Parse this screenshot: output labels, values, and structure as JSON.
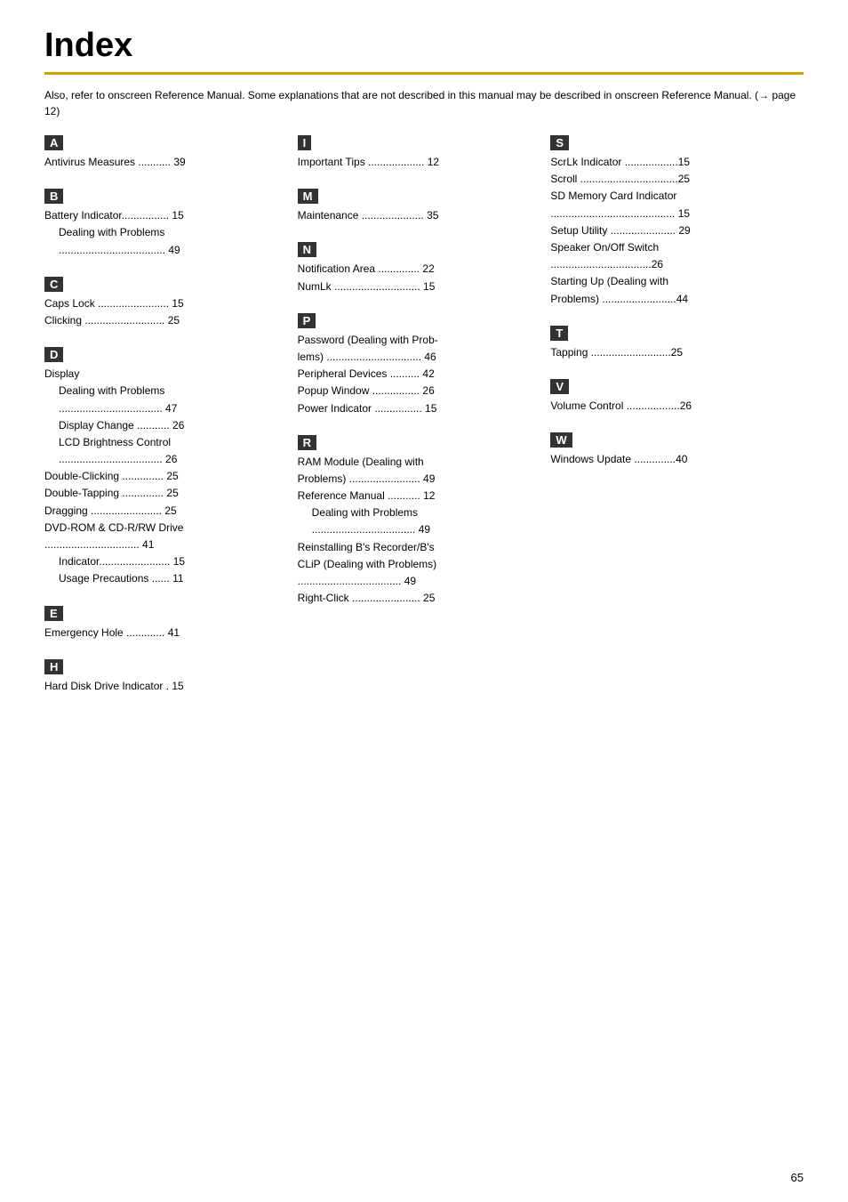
{
  "page": {
    "title": "Index",
    "intro": "Also, refer to onscreen Reference Manual. Some explanations that are not described in this manual may be described in onscreen Reference Manual. (→ page 12)",
    "footer_page": "65"
  },
  "columns": [
    {
      "id": "col1",
      "sections": [
        {
          "letter": "A",
          "entries": [
            {
              "text": "Antivirus Measures ........... 39",
              "indent": 0
            }
          ]
        },
        {
          "letter": "B",
          "entries": [
            {
              "text": "Battery Indicator................ 15",
              "indent": 0
            },
            {
              "text": "Dealing with Problems",
              "indent": 1
            },
            {
              "text": ".................................... 49",
              "indent": 1
            }
          ]
        },
        {
          "letter": "C",
          "entries": [
            {
              "text": "Caps Lock ........................ 15",
              "indent": 0
            },
            {
              "text": "Clicking  ........................... 25",
              "indent": 0
            }
          ]
        },
        {
          "letter": "D",
          "entries": [
            {
              "text": "Display",
              "indent": 0
            },
            {
              "text": "Dealing with Problems",
              "indent": 1
            },
            {
              "text": "................................... 47",
              "indent": 1
            },
            {
              "text": "Display Change ........... 26",
              "indent": 1
            },
            {
              "text": "LCD Brightness Control",
              "indent": 1
            },
            {
              "text": "................................... 26",
              "indent": 1
            },
            {
              "text": "Double-Clicking .............. 25",
              "indent": 0
            },
            {
              "text": "Double-Tapping .............. 25",
              "indent": 0
            },
            {
              "text": "Dragging  ........................ 25",
              "indent": 0
            },
            {
              "text": "DVD-ROM & CD-R/RW Drive",
              "indent": 0
            },
            {
              "text": "................................ 41",
              "indent": 0
            },
            {
              "text": "Indicator........................ 15",
              "indent": 1
            },
            {
              "text": "Usage Precautions ...... 11",
              "indent": 1
            }
          ]
        },
        {
          "letter": "E",
          "entries": [
            {
              "text": "Emergency Hole  ............. 41",
              "indent": 0
            }
          ]
        },
        {
          "letter": "H",
          "entries": [
            {
              "text": "Hard Disk Drive Indicator  . 15",
              "indent": 0
            }
          ]
        }
      ]
    },
    {
      "id": "col2",
      "sections": [
        {
          "letter": "I",
          "entries": [
            {
              "text": "Important Tips ................... 12",
              "indent": 0
            }
          ]
        },
        {
          "letter": "M",
          "entries": [
            {
              "text": "Maintenance  ..................... 35",
              "indent": 0
            }
          ]
        },
        {
          "letter": "N",
          "entries": [
            {
              "text": "Notification Area  .............. 22",
              "indent": 0
            },
            {
              "text": "NumLk  ............................. 15",
              "indent": 0
            }
          ]
        },
        {
          "letter": "P",
          "entries": [
            {
              "text": "Password (Dealing with Prob-",
              "indent": 0
            },
            {
              "text": "lems) ................................ 46",
              "indent": 0
            },
            {
              "text": "Peripheral Devices  .......... 42",
              "indent": 0
            },
            {
              "text": "Popup Window  ................ 26",
              "indent": 0
            },
            {
              "text": "Power Indicator  ................ 15",
              "indent": 0
            }
          ]
        },
        {
          "letter": "R",
          "entries": [
            {
              "text": "RAM  Module  (Dealing  with",
              "indent": 0
            },
            {
              "text": "Problems)  ........................ 49",
              "indent": 0
            },
            {
              "text": "Reference Manual  ........... 12",
              "indent": 0
            },
            {
              "text": "Dealing with Problems",
              "indent": 1
            },
            {
              "text": "................................... 49",
              "indent": 1
            },
            {
              "text": "Reinstalling B's  Recorder/B's",
              "indent": 0
            },
            {
              "text": "CLiP (Dealing with Problems)",
              "indent": 0
            },
            {
              "text": "................................... 49",
              "indent": 0
            },
            {
              "text": "Right-Click  ....................... 25",
              "indent": 0
            }
          ]
        }
      ]
    },
    {
      "id": "col3",
      "sections": [
        {
          "letter": "S",
          "entries": [
            {
              "text": "ScrLk Indicator ..................15",
              "indent": 0
            },
            {
              "text": "Scroll  .................................25",
              "indent": 0
            },
            {
              "text": "SD Memory Card Indicator",
              "indent": 0
            },
            {
              "text": ".......................................... 15",
              "indent": 0
            },
            {
              "text": "Setup Utility ...................... 29",
              "indent": 0
            },
            {
              "text": "Speaker On/Off Switch",
              "indent": 0
            },
            {
              "text": "..................................26",
              "indent": 0
            },
            {
              "text": "Starting  Up  (Dealing  with",
              "indent": 0
            },
            {
              "text": "Problems) .........................44",
              "indent": 0
            }
          ]
        },
        {
          "letter": "T",
          "entries": [
            {
              "text": "Tapping  ...........................25",
              "indent": 0
            }
          ]
        },
        {
          "letter": "V",
          "entries": [
            {
              "text": "Volume Control ..................26",
              "indent": 0
            }
          ]
        },
        {
          "letter": "W",
          "entries": [
            {
              "text": "Windows Update ..............40",
              "indent": 0
            }
          ]
        }
      ]
    }
  ]
}
